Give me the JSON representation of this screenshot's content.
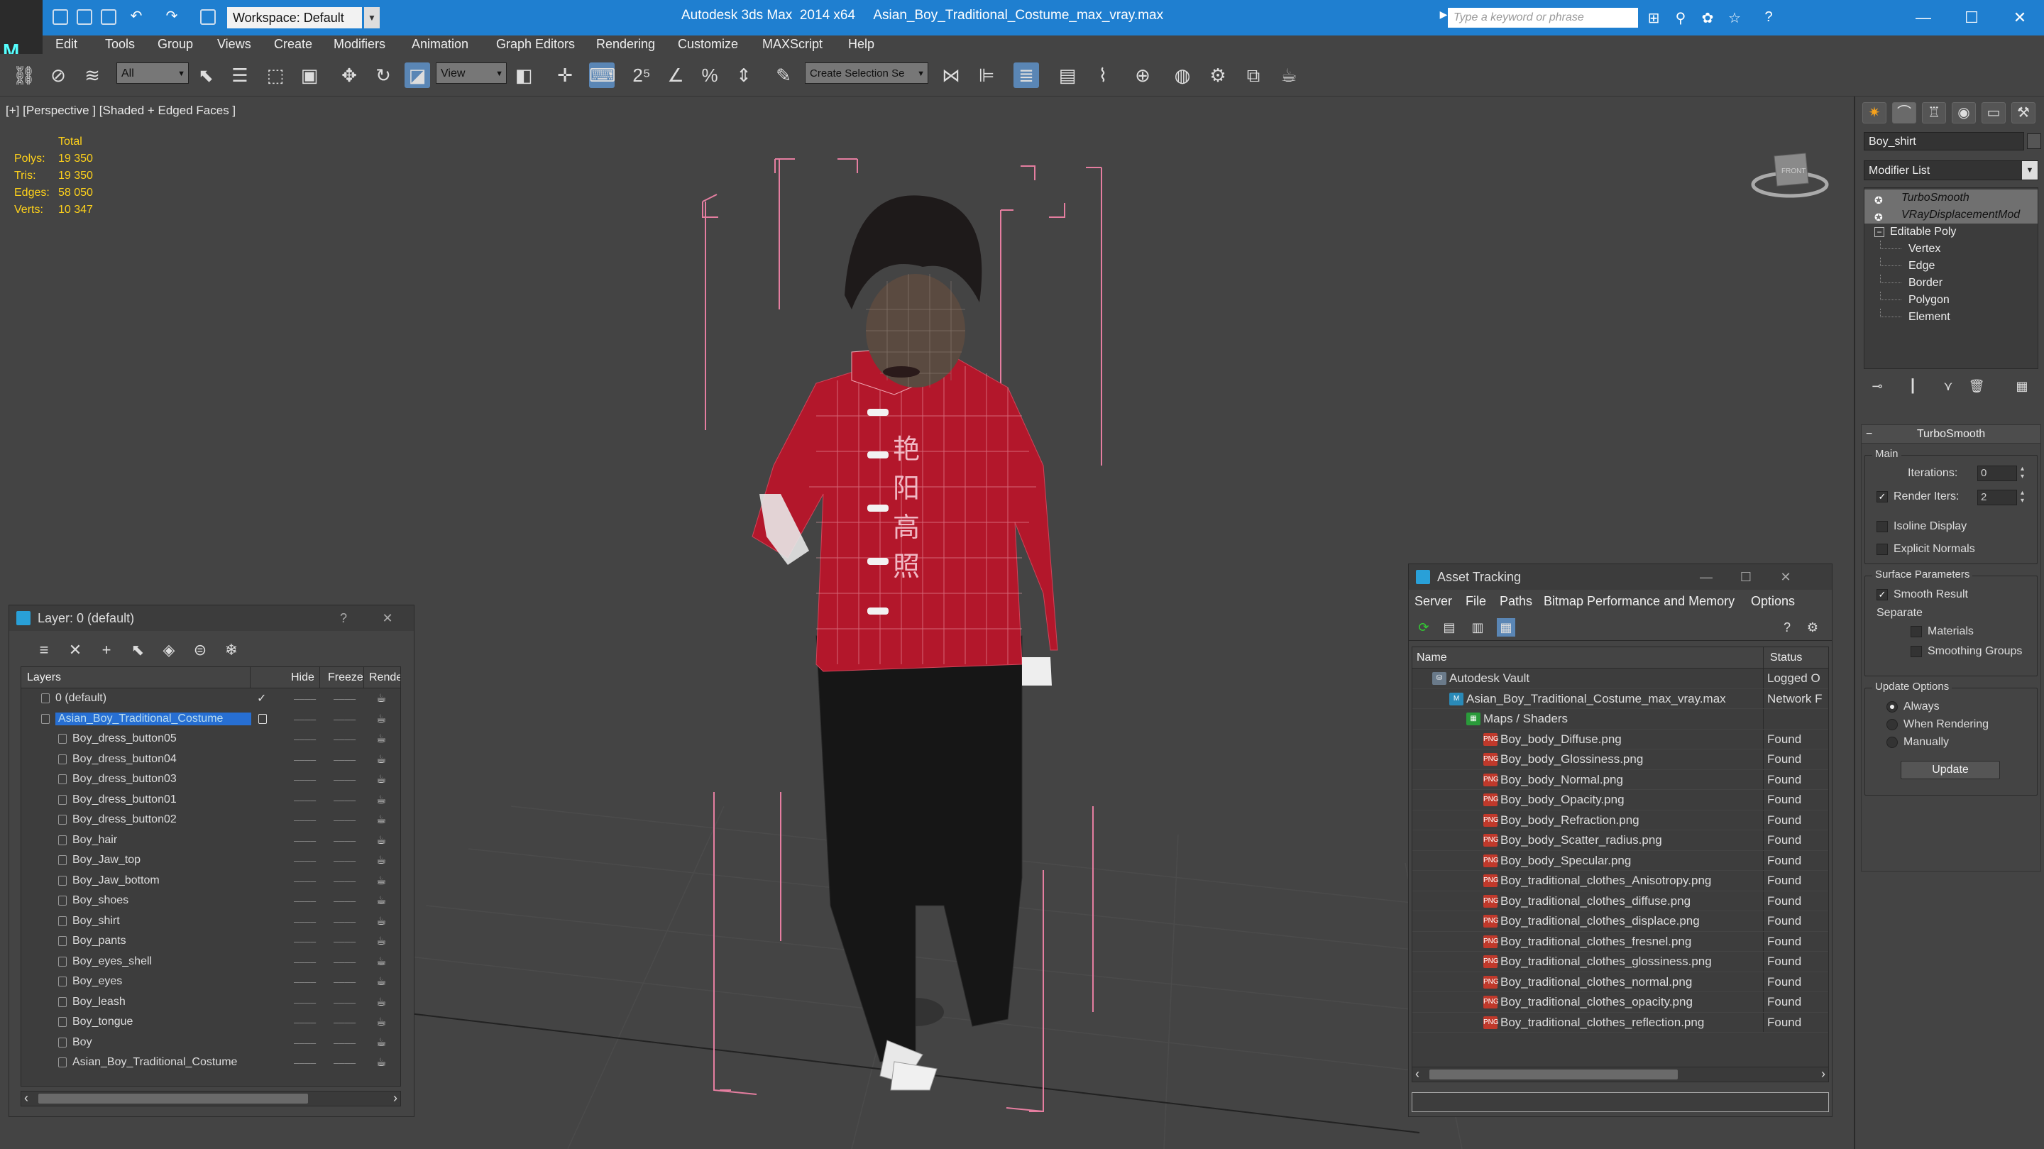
{
  "titlebar": {
    "workspace_label": "Workspace: Default",
    "app_title": "Autodesk 3ds Max  2014 x64     Asian_Boy_Traditional_Costume_max_vray.max",
    "search_placeholder": "Type a keyword or phrase"
  },
  "menu": [
    "Edit",
    "Tools",
    "Group",
    "Views",
    "Create",
    "Modifiers",
    "Animation",
    "Graph Editors",
    "Rendering",
    "Customize",
    "MAXScript",
    "Help"
  ],
  "toolbar": {
    "selection_filter": "All",
    "ref_coord": "View",
    "named_selection": "Create Selection Se"
  },
  "viewport": {
    "label": "[+] [Perspective ] [Shaded + Edged Faces ]",
    "stats_header": "Total",
    "stats": [
      {
        "k": "Polys:",
        "v": "19 350"
      },
      {
        "k": "Tris:",
        "v": "19 350"
      },
      {
        "k": "Edges:",
        "v": "58 050"
      },
      {
        "k": "Verts:",
        "v": "10 347"
      }
    ],
    "shirt_text": "艳阳高照",
    "viewcube_label": "FRONT"
  },
  "command_panel": {
    "object_name": "Boy_shirt",
    "modifier_list": "Modifier List",
    "stack": {
      "modifiers": [
        "TurboSmooth",
        "VRayDisplacementMod"
      ],
      "base": "Editable Poly",
      "sub": [
        "Vertex",
        "Edge",
        "Border",
        "Polygon",
        "Element"
      ]
    },
    "turbosmooth": {
      "title": "TurboSmooth",
      "main": "Main",
      "iterations_label": "Iterations:",
      "iterations": "0",
      "render_iters_label": "Render Iters:",
      "render_iters": "2",
      "isoline": "Isoline Display",
      "explicit": "Explicit Normals",
      "surface": "Surface Parameters",
      "smooth": "Smooth Result",
      "separate": "Separate",
      "materials": "Materials",
      "smoothing": "Smoothing Groups",
      "update_opts": "Update Options",
      "always": "Always",
      "when_rendering": "When Rendering",
      "manually": "Manually",
      "update_btn": "Update"
    }
  },
  "layer_window": {
    "title": "Layer: 0 (default)",
    "help": "?",
    "columns": [
      "Layers",
      "Hide",
      "Freeze",
      "Render"
    ],
    "default_layer": "0 (default)",
    "selected_layer": "Asian_Boy_Traditional_Costume",
    "objects": [
      "Boy_dress_button05",
      "Boy_dress_button04",
      "Boy_dress_button03",
      "Boy_dress_button01",
      "Boy_dress_button02",
      "Boy_hair",
      "Boy_Jaw_top",
      "Boy_Jaw_bottom",
      "Boy_shoes",
      "Boy_shirt",
      "Boy_pants",
      "Boy_eyes_shell",
      "Boy_eyes",
      "Boy_leash",
      "Boy_tongue",
      "Boy",
      "Asian_Boy_Traditional_Costume"
    ]
  },
  "asset_window": {
    "title": "Asset Tracking",
    "menu": [
      "Server",
      "File",
      "Paths",
      "Bitmap Performance and Memory",
      "Options"
    ],
    "columns": [
      "Name",
      "Status"
    ],
    "rows": [
      {
        "name": "Autodesk Vault",
        "status": "Logged O",
        "indent": 0,
        "kind": "vault"
      },
      {
        "name": "Asian_Boy_Traditional_Costume_max_vray.max",
        "status": "Network F",
        "indent": 1,
        "kind": "max"
      },
      {
        "name": "Maps / Shaders",
        "status": "",
        "indent": 2,
        "kind": "maps"
      },
      {
        "name": "Boy_body_Diffuse.png",
        "status": "Found",
        "indent": 3,
        "kind": "png"
      },
      {
        "name": "Boy_body_Glossiness.png",
        "status": "Found",
        "indent": 3,
        "kind": "png"
      },
      {
        "name": "Boy_body_Normal.png",
        "status": "Found",
        "indent": 3,
        "kind": "png"
      },
      {
        "name": "Boy_body_Opacity.png",
        "status": "Found",
        "indent": 3,
        "kind": "png"
      },
      {
        "name": "Boy_body_Refraction.png",
        "status": "Found",
        "indent": 3,
        "kind": "png"
      },
      {
        "name": "Boy_body_Scatter_radius.png",
        "status": "Found",
        "indent": 3,
        "kind": "png"
      },
      {
        "name": "Boy_body_Specular.png",
        "status": "Found",
        "indent": 3,
        "kind": "png"
      },
      {
        "name": "Boy_traditional_clothes_Anisotropy.png",
        "status": "Found",
        "indent": 3,
        "kind": "png"
      },
      {
        "name": "Boy_traditional_clothes_diffuse.png",
        "status": "Found",
        "indent": 3,
        "kind": "png"
      },
      {
        "name": "Boy_traditional_clothes_displace.png",
        "status": "Found",
        "indent": 3,
        "kind": "png"
      },
      {
        "name": "Boy_traditional_clothes_fresnel.png",
        "status": "Found",
        "indent": 3,
        "kind": "png"
      },
      {
        "name": "Boy_traditional_clothes_glossiness.png",
        "status": "Found",
        "indent": 3,
        "kind": "png"
      },
      {
        "name": "Boy_traditional_clothes_normal.png",
        "status": "Found",
        "indent": 3,
        "kind": "png"
      },
      {
        "name": "Boy_traditional_clothes_opacity.png",
        "status": "Found",
        "indent": 3,
        "kind": "png"
      },
      {
        "name": "Boy_traditional_clothes_reflection.png",
        "status": "Found",
        "indent": 3,
        "kind": "png"
      }
    ]
  }
}
